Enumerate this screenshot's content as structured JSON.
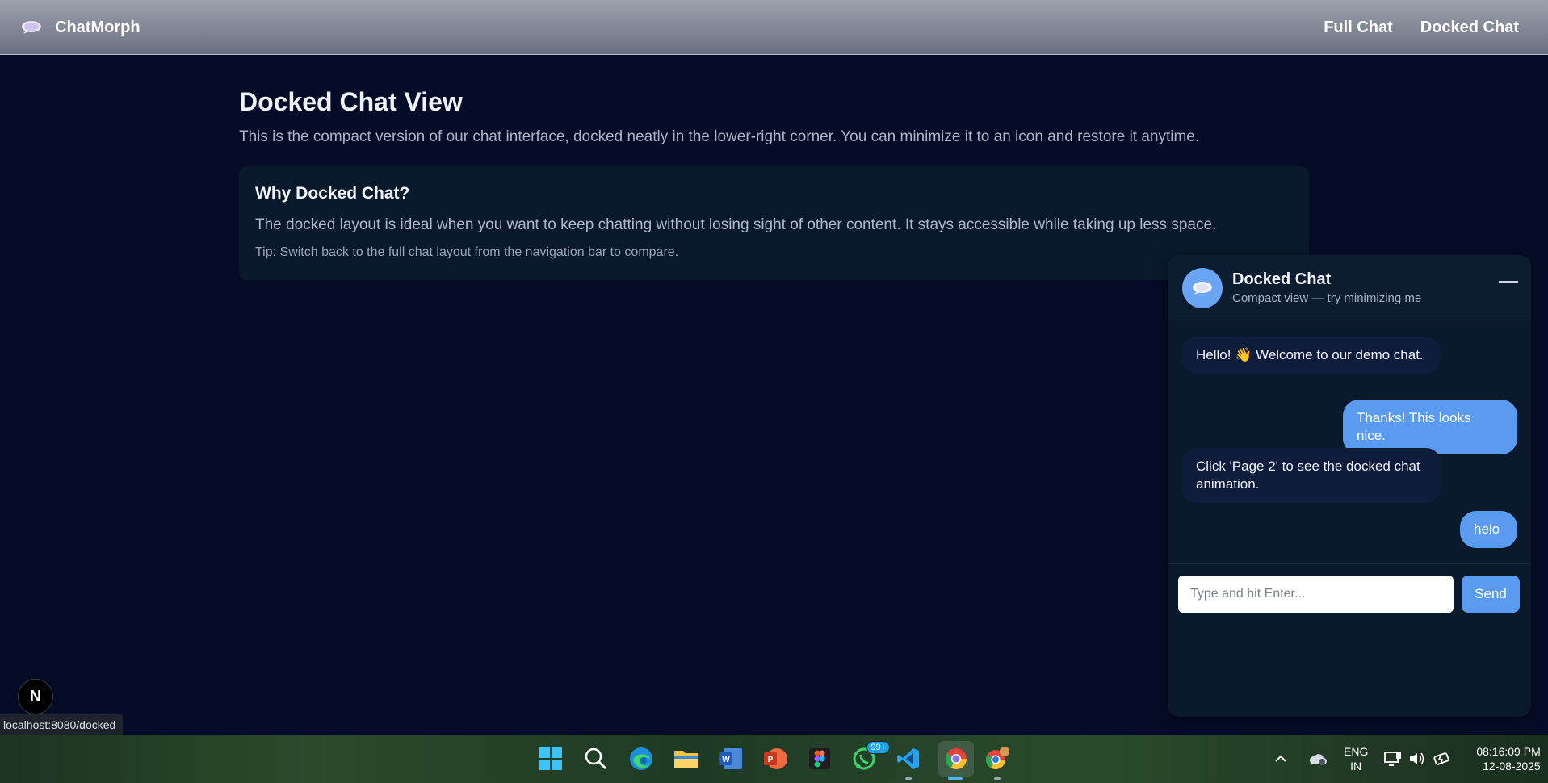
{
  "topnav": {
    "brand": "ChatMorph",
    "links": [
      "Full Chat",
      "Docked Chat"
    ]
  },
  "main": {
    "title": "Docked Chat View",
    "description": "This is the compact version of our chat interface, docked neatly in the lower-right corner. You can minimize it to an icon and restore it anytime.",
    "card": {
      "title": "Why Docked Chat?",
      "text": "The docked layout is ideal when you want to keep chatting without losing sight of other content. It stays accessible while taking up less space.",
      "tip": "Tip: Switch back to the full chat layout from the navigation bar to compare."
    }
  },
  "dock": {
    "title": "Docked Chat",
    "subtitle": "Compact view — try minimizing me",
    "messages": [
      {
        "from": "bot",
        "text": "Hello! 👋 Welcome to our demo chat."
      },
      {
        "from": "user",
        "text": "Thanks! This looks nice."
      },
      {
        "from": "bot",
        "text": "Click 'Page 2' to see the docked chat animation."
      },
      {
        "from": "user",
        "text": "helo"
      }
    ],
    "input_placeholder": "Type and hit Enter...",
    "send_label": "Send"
  },
  "dev": {
    "next_badge": "N",
    "status_url": "localhost:8080/docked"
  },
  "taskbar": {
    "apps": [
      "windows-start",
      "search",
      "edge",
      "file-explorer",
      "word",
      "powerpoint",
      "figma",
      "whatsapp",
      "vscode",
      "chrome",
      "chrome-profile"
    ],
    "whatsapp_badge": "99+",
    "lang_line1": "ENG",
    "lang_line2": "IN",
    "time": "08:16:09 PM",
    "date": "12-08-2025"
  },
  "colors": {
    "background": "#050c27",
    "accent": "#5a9bf0",
    "bot_bubble": "#0f1c3b",
    "panel": "#0a1a2c"
  }
}
